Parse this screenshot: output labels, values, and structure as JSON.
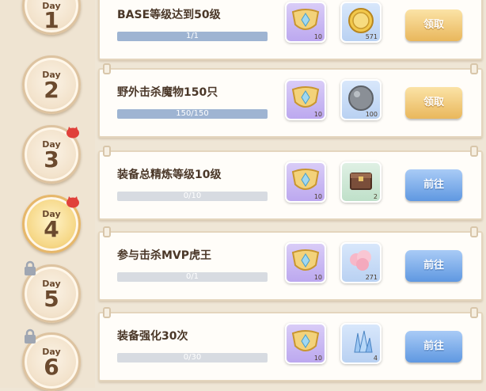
{
  "days": [
    {
      "label": "Day",
      "num": "1",
      "state": "done"
    },
    {
      "label": "Day",
      "num": "2",
      "state": "normal"
    },
    {
      "label": "Day",
      "num": "3",
      "state": "badge"
    },
    {
      "label": "Day",
      "num": "4",
      "state": "active-badge"
    },
    {
      "label": "Day",
      "num": "5",
      "state": "locked"
    },
    {
      "label": "Day",
      "num": "6",
      "state": "locked"
    }
  ],
  "tasks": [
    {
      "title": "BASE等级达到50级",
      "progress_text": "1/1",
      "progress": 1.0,
      "rewards": [
        {
          "icon": "badge-icon",
          "qty": "10"
        },
        {
          "icon": "coin-icon",
          "qty": "571"
        }
      ],
      "button": "领取",
      "button_type": "claim"
    },
    {
      "title": "野外击杀魔物150只",
      "progress_text": "150/150",
      "progress": 1.0,
      "rewards": [
        {
          "icon": "badge-icon",
          "qty": "10"
        },
        {
          "icon": "stone-icon",
          "qty": "100"
        }
      ],
      "button": "领取",
      "button_type": "claim"
    },
    {
      "title": "装备总精炼等级10级",
      "progress_text": "0/10",
      "progress": 0.0,
      "rewards": [
        {
          "icon": "badge-icon",
          "qty": "10"
        },
        {
          "icon": "chest-icon",
          "qty": "2"
        }
      ],
      "button": "前往",
      "button_type": "go"
    },
    {
      "title": "参与击杀MVP虎王",
      "progress_text": "0/1",
      "progress": 0.0,
      "rewards": [
        {
          "icon": "badge-icon",
          "qty": "10"
        },
        {
          "icon": "cotton-candy-icon",
          "qty": "271"
        }
      ],
      "button": "前往",
      "button_type": "go"
    },
    {
      "title": "装备强化30次",
      "progress_text": "0/30",
      "progress": 0.0,
      "rewards": [
        {
          "icon": "badge-icon",
          "qty": "10"
        },
        {
          "icon": "crystal-icon",
          "qty": "4"
        }
      ],
      "button": "前往",
      "button_type": "go"
    }
  ]
}
